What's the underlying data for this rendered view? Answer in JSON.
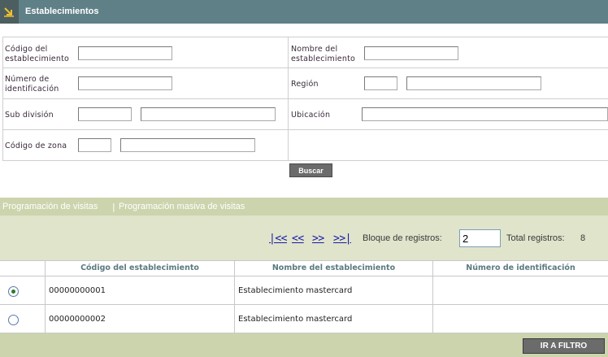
{
  "header": {
    "title": "Establecimientos",
    "icon": "arrow-down-right-icon",
    "colors": {
      "bar": "#5f8087",
      "icon_box": "#4c5e5f",
      "icon": "#f0c030"
    }
  },
  "filters": {
    "codigo_establecimiento": {
      "label": "Código del establecimiento",
      "value": ""
    },
    "nombre_establecimiento": {
      "label": "Nombre del establecimiento",
      "value": ""
    },
    "numero_identificacion": {
      "label": "Número de identificación",
      "value": ""
    },
    "region": {
      "label": "Región",
      "code": "",
      "value": ""
    },
    "sub_division": {
      "label": "Sub división",
      "code": "",
      "value": ""
    },
    "ubicacion": {
      "label": "Ubicación",
      "value": ""
    },
    "codigo_zona": {
      "label": "Código de zona",
      "code": "",
      "value": ""
    },
    "search_button": "Buscar"
  },
  "tabs": [
    {
      "label": "Programación de visitas"
    },
    {
      "label": "Programación masiva de visitas"
    }
  ],
  "tab_separator": "|",
  "pager": {
    "first": "|<<",
    "prev": "<<",
    "next": ">>",
    "last": ">>|",
    "block_label": "Bloque de registros:",
    "block_value": "2",
    "total_label": "Total registros:",
    "total_value": "8"
  },
  "table": {
    "columns": [
      "Código del establecimiento",
      "Nombre del establecimiento",
      "Número de identificación"
    ],
    "rows": [
      {
        "selected": true,
        "codigo": "00000000001",
        "nombre": "Establecimiento mastercard",
        "numero": ""
      },
      {
        "selected": false,
        "codigo": "00000000002",
        "nombre": "Establecimiento mastercard",
        "numero": ""
      }
    ]
  },
  "footer": {
    "button": "IR A FILTRO"
  }
}
